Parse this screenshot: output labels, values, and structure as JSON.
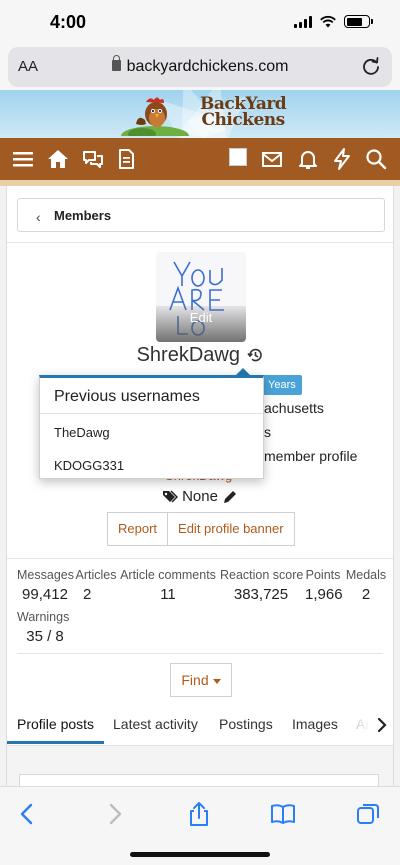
{
  "status_bar": {
    "time": "4:00"
  },
  "browser": {
    "aa_label": "AA",
    "url": "backyardchickens.com"
  },
  "site": {
    "logo_line1": "BackYard",
    "logo_line2": "Chickens"
  },
  "breadcrumb": {
    "label": "Members"
  },
  "profile": {
    "avatar_text": "You ARE Love",
    "avatar_edit": "Edit",
    "username": "ShrekDawg",
    "years_badge": "Years",
    "location_partial": "achusetts",
    "line2_partial": "s",
    "member_profile_partial": "member profile",
    "user_link_partial": "ShrekDawg",
    "tags_value": "None",
    "report_button": "Report",
    "edit_banner_button": "Edit profile banner"
  },
  "stats": {
    "items": [
      {
        "label": "Messages",
        "value": "99,412"
      },
      {
        "label": "Articles",
        "value": "2"
      },
      {
        "label": "Article comments",
        "value": "11"
      },
      {
        "label": "Reaction score",
        "value": "383,725"
      },
      {
        "label": "Points",
        "value": "1,966"
      },
      {
        "label": "Medals",
        "value": "2"
      },
      {
        "label": "Warnings",
        "value": "35 / 8"
      }
    ]
  },
  "find_button": "Find",
  "tabs": {
    "items": [
      {
        "label": "Profile posts",
        "active": true
      },
      {
        "label": "Latest activity"
      },
      {
        "label": "Postings"
      },
      {
        "label": "Images"
      },
      {
        "label": "Ar"
      }
    ]
  },
  "popup": {
    "title": "Previous usernames",
    "items": [
      "TheDawg",
      "KDOGG331"
    ]
  },
  "colors": {
    "nav_brown": "#a05a22",
    "accent_blue": "#2577b1",
    "link_orange": "#b25a1a"
  }
}
